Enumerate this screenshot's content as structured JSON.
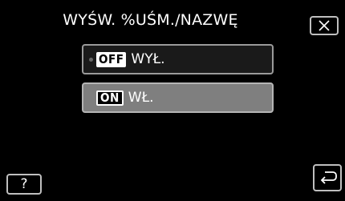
{
  "header": {
    "title": "WYŚW. %UŚM./NAZWĘ"
  },
  "options": [
    {
      "badge": "OFF",
      "label": "WYŁ."
    },
    {
      "badge": "ON",
      "label": "WŁ."
    }
  ],
  "footer": {
    "help_label": "?"
  },
  "icons": {
    "close": "close-icon",
    "back": "return-arrow-icon"
  },
  "colors": {
    "background": "#000000",
    "selected_option": "#7f7f7f",
    "text": "#ffffff"
  }
}
